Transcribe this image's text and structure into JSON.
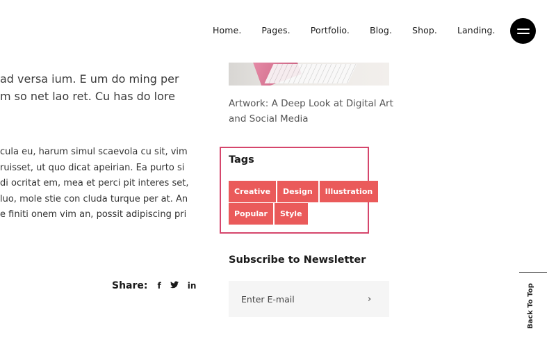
{
  "nav": {
    "items": [
      "Home.",
      "Pages.",
      "Portfolio.",
      "Blog.",
      "Shop.",
      "Landing."
    ],
    "menu_icon": "hamburger-icon"
  },
  "article": {
    "lead_lines": [
      "ad versa ium. E um do ming per",
      "m so net lao ret. Cu has do lore"
    ],
    "body_lines": [
      "cula eu, harum simul scaevola cu sit, vim",
      "ruisset, ut quo dicat apeirian. Ea purto si",
      "di ocritat em, mea et perci pit interes set,",
      "luo, mole stie con cluda turque per at. An",
      "e finiti onem vim an, possit adipiscing pri"
    ],
    "share": {
      "label": "Share:",
      "icons": [
        {
          "name": "facebook-icon",
          "glyph": "f"
        },
        {
          "name": "twitter-icon",
          "glyph": "🐦"
        },
        {
          "name": "linkedin-icon",
          "glyph": "in"
        }
      ]
    }
  },
  "sidebar": {
    "recent_post": {
      "title": "Artwork: A Deep Look at Digital Art and Social Media"
    },
    "tags": {
      "title": "Tags",
      "row1": [
        "Creative",
        "Design",
        "Illustration"
      ],
      "row2": [
        "Popular",
        "Style"
      ],
      "accent": "#ea5a5a",
      "highlight_border": "#d5466c"
    },
    "newsletter": {
      "title": "Subscribe to Newsletter",
      "placeholder": "Enter E-mail",
      "submit_glyph": "›"
    }
  },
  "back_to_top": "Back To Top"
}
